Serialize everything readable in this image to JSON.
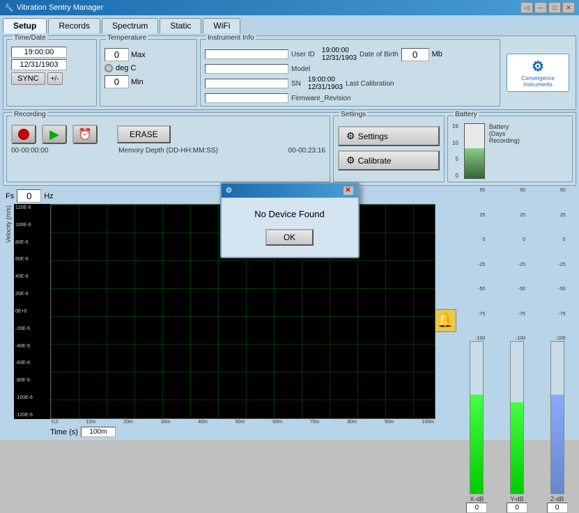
{
  "window": {
    "title": "Vibration Sentry Manager",
    "controls": [
      "minimize",
      "maximize",
      "close"
    ]
  },
  "tabs": [
    {
      "label": "Setup",
      "active": true
    },
    {
      "label": "Records",
      "active": false
    },
    {
      "label": "Spectrum",
      "active": false
    },
    {
      "label": "Static",
      "active": false
    },
    {
      "label": "WiFi",
      "active": false
    }
  ],
  "setup": {
    "timedate": {
      "label": "Time/Date",
      "time": "19:00:00",
      "date": "12/31/1903",
      "sync_btn": "SYNC",
      "plus_minus_btn": "+/-"
    },
    "temperature": {
      "label": "Temperature",
      "max_label": "Max",
      "min_label": "Min",
      "max_val": "0",
      "min_val": "0",
      "unit": "deg C"
    },
    "instrument_info": {
      "label": "Instrument Info",
      "user_id_label": "User ID",
      "model_label": "Model",
      "sn_label": "SN",
      "firmware_label": "Firmware_Revision",
      "date_of_birth_label": "Date of Birth",
      "last_calibration_label": "Last Calibration",
      "dob_time": "19:00:00",
      "dob_date": "12/31/1903",
      "cal_time": "19:00:00",
      "cal_date": "12/31/1903",
      "mb_label": "Mb",
      "mb_val": "0"
    },
    "recording": {
      "label": "Recording",
      "erase_btn": "ERASE",
      "start_time": "00-00:00:00",
      "end_time": "00-00:23:16",
      "memory_label": "Memory Depth (DD-HH:MM:SS)"
    },
    "settings": {
      "label": "Settings",
      "settings_btn": "Settings",
      "calibrate_btn": "Calibrate"
    },
    "battery": {
      "label": "Battery",
      "bar_label": "Battery\n(Days Recording)",
      "scale": [
        "16",
        "10",
        "5",
        "0"
      ]
    },
    "chart": {
      "fs_label": "Fs",
      "fs_val": "0",
      "hz_label": "Hz",
      "y_axis_label": "Velocity (m/s)",
      "y_labels": [
        "120E-6",
        "100E-6",
        "80E-6",
        "60E-6",
        "40E-6",
        "20E-6",
        "0E+0",
        "-20E-6",
        "-40E-6",
        "-60E-6",
        "-80E-6",
        "-100E-6",
        "-120E-6"
      ],
      "x_labels": [
        "0,0",
        "10m",
        "20m",
        "30m",
        "40m",
        "50m",
        "60m",
        "70m",
        "80m",
        "90m",
        "100m"
      ],
      "time_label": "Time (s)",
      "range_val": "100m"
    },
    "level_meters": {
      "x": {
        "label": "X-dB",
        "val": "0",
        "scale": [
          "50",
          "25",
          "0",
          "-25",
          "-50",
          "-75",
          "-100"
        ],
        "fill_pct": 65
      },
      "y": {
        "label": "Y-dB",
        "val": "0",
        "scale": [
          "50",
          "25",
          "0",
          "-25",
          "-50",
          "-75",
          "-100"
        ],
        "fill_pct": 60
      },
      "z": {
        "label": "Z-dB",
        "val": "0",
        "scale": [
          "50",
          "25",
          "0",
          "-25",
          "-50",
          "-75",
          "-100"
        ],
        "fill_pct": 65
      }
    }
  },
  "dialog": {
    "title": "⚙",
    "message": "No Device Found",
    "ok_btn": "OK"
  }
}
